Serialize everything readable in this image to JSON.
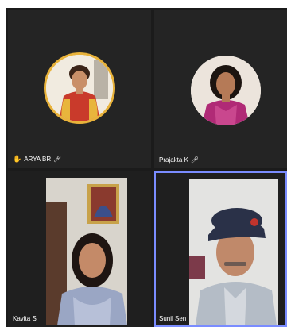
{
  "participants": [
    {
      "name": "ARYA BR",
      "hand_raised": true,
      "hand_icon": "raised-hand-icon",
      "mic_icon": "mic-muted-icon",
      "accent": "#e8b23a"
    },
    {
      "name": "Prajakta K",
      "hand_raised": false,
      "mic_icon": "mic-muted-icon"
    },
    {
      "name": "Kavita S"
    },
    {
      "name": "Sunil Sen",
      "active_speaker": true,
      "accent": "#7a8cff"
    }
  ]
}
